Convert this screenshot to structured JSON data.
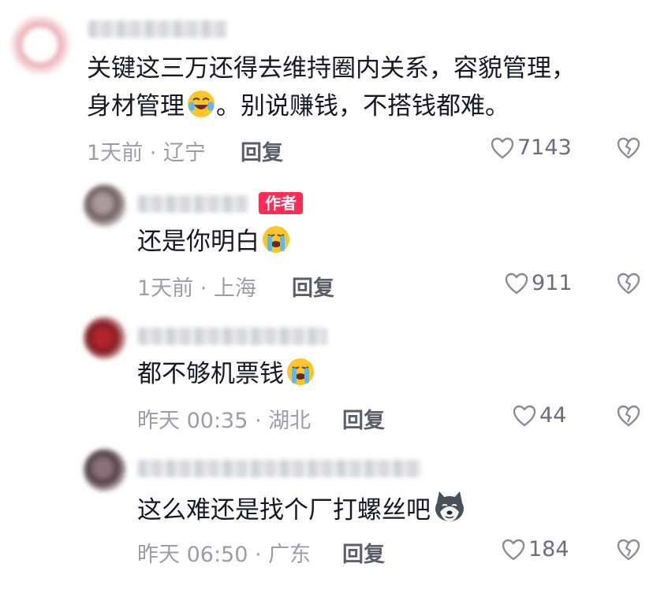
{
  "comments": [
    {
      "text_line1": "关键这三万还得去维持圈内关系，容貌管理，",
      "text_line2_a": "身材管理",
      "text_line2_b": "。别说赚钱，不搭钱都难。",
      "meta": "1天前 · 辽宁",
      "reply": "回复",
      "likes": "7143"
    },
    {
      "author_tag": "作者",
      "text": "还是你明白",
      "meta": "1天前 · 上海",
      "reply": "回复",
      "likes": "911"
    },
    {
      "text": "都不够机票钱",
      "meta": "昨天 00:35 · 湖北",
      "reply": "回复",
      "likes": "44"
    },
    {
      "text": "这么难还是找个厂打螺丝吧",
      "meta": "昨天 06:50 · 广东",
      "reply": "回复",
      "likes": "184"
    }
  ],
  "icons": {
    "like": "heart-outline-icon",
    "dislike": "broken-heart-icon",
    "emoji_laugh_cry": "rofl-emoji",
    "emoji_cry": "loudly-crying-emoji",
    "emoji_husky": "husky-dog-sticker"
  },
  "colors": {
    "author_tag_bg": "#fe2c55",
    "meta_text": "#9b9ea6",
    "reply_text": "#5b5e69"
  }
}
